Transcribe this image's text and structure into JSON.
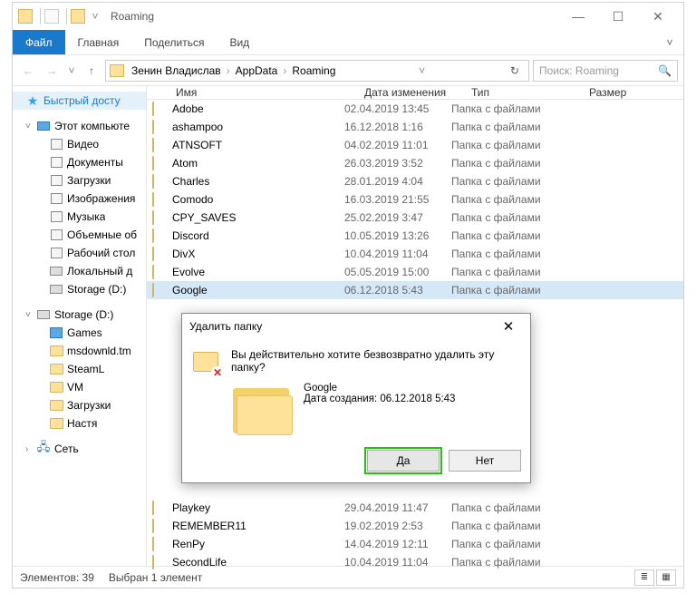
{
  "window": {
    "title": "Roaming",
    "min": "—",
    "max": "☐",
    "close": "✕"
  },
  "ribbon": {
    "file": "Файл",
    "home": "Главная",
    "share": "Поделиться",
    "view": "Вид",
    "expand": "˅"
  },
  "nav": {
    "back": "←",
    "forward": "→",
    "recent": "˅",
    "up": "↑"
  },
  "address": {
    "segs": [
      "Зенин Владислав",
      "AppData",
      "Roaming"
    ],
    "refresh": "↻",
    "dropdown": "˅"
  },
  "search": {
    "placeholder": "Поиск: Roaming",
    "icon": "🔍"
  },
  "sidebar": {
    "quick": "Быстрый досту",
    "thispc": "Этот компьюте",
    "pc_items": [
      "Видео",
      "Документы",
      "Загрузки",
      "Изображения",
      "Музыка",
      "Объемные об",
      "Рабочий стол",
      "Локальный д",
      "Storage (D:)"
    ],
    "storage": "Storage (D:)",
    "storage_items": [
      "Games",
      "msdownld.tm",
      "SteamL",
      "VM",
      "Загрузки",
      "Настя"
    ],
    "network": "Сеть"
  },
  "columns": {
    "name": "Имя",
    "date": "Дата изменения",
    "type": "Тип",
    "size": "Размер"
  },
  "rows": [
    {
      "name": "Adobe",
      "date": "02.04.2019 13:45",
      "type": "Папка с файлами"
    },
    {
      "name": "ashampoo",
      "date": "16.12.2018 1:16",
      "type": "Папка с файлами"
    },
    {
      "name": "ATNSOFT",
      "date": "04.02.2019 11:01",
      "type": "Папка с файлами"
    },
    {
      "name": "Atom",
      "date": "26.03.2019 3:52",
      "type": "Папка с файлами"
    },
    {
      "name": "Charles",
      "date": "28.01.2019 4:04",
      "type": "Папка с файлами"
    },
    {
      "name": "Comodo",
      "date": "16.03.2019 21:55",
      "type": "Папка с файлами"
    },
    {
      "name": "CPY_SAVES",
      "date": "25.02.2019 3:47",
      "type": "Папка с файлами"
    },
    {
      "name": "Discord",
      "date": "10.05.2019 13:26",
      "type": "Папка с файлами"
    },
    {
      "name": "DivX",
      "date": "10.04.2019 11:04",
      "type": "Папка с файлами"
    },
    {
      "name": "Evolve",
      "date": "05.05.2019 15:00",
      "type": "Папка с файлами"
    },
    {
      "name": "Google",
      "date": "06.12.2018 5:43",
      "type": "Папка с файлами",
      "selected": true
    }
  ],
  "rows_after": [
    {
      "name": "Playkey",
      "date": "29.04.2019 11:47",
      "type": "Папка с файлами"
    },
    {
      "name": "REMEMBER11",
      "date": "19.02.2019 2:53",
      "type": "Папка с файлами"
    },
    {
      "name": "RenPy",
      "date": "14.04.2019 12:11",
      "type": "Папка с файлами"
    },
    {
      "name": "SecondLife",
      "date": "10.04.2019 11:04",
      "type": "Папка с файлами"
    }
  ],
  "status": {
    "count": "Элементов: 39",
    "selected": "Выбран 1 элемент"
  },
  "dialog": {
    "title": "Удалить папку",
    "close": "✕",
    "heading": "Вы действительно хотите безвозвратно удалить эту папку?",
    "item_name": "Google",
    "item_meta": "Дата создания: 06.12.2018 5:43",
    "yes": "Да",
    "no": "Нет"
  }
}
